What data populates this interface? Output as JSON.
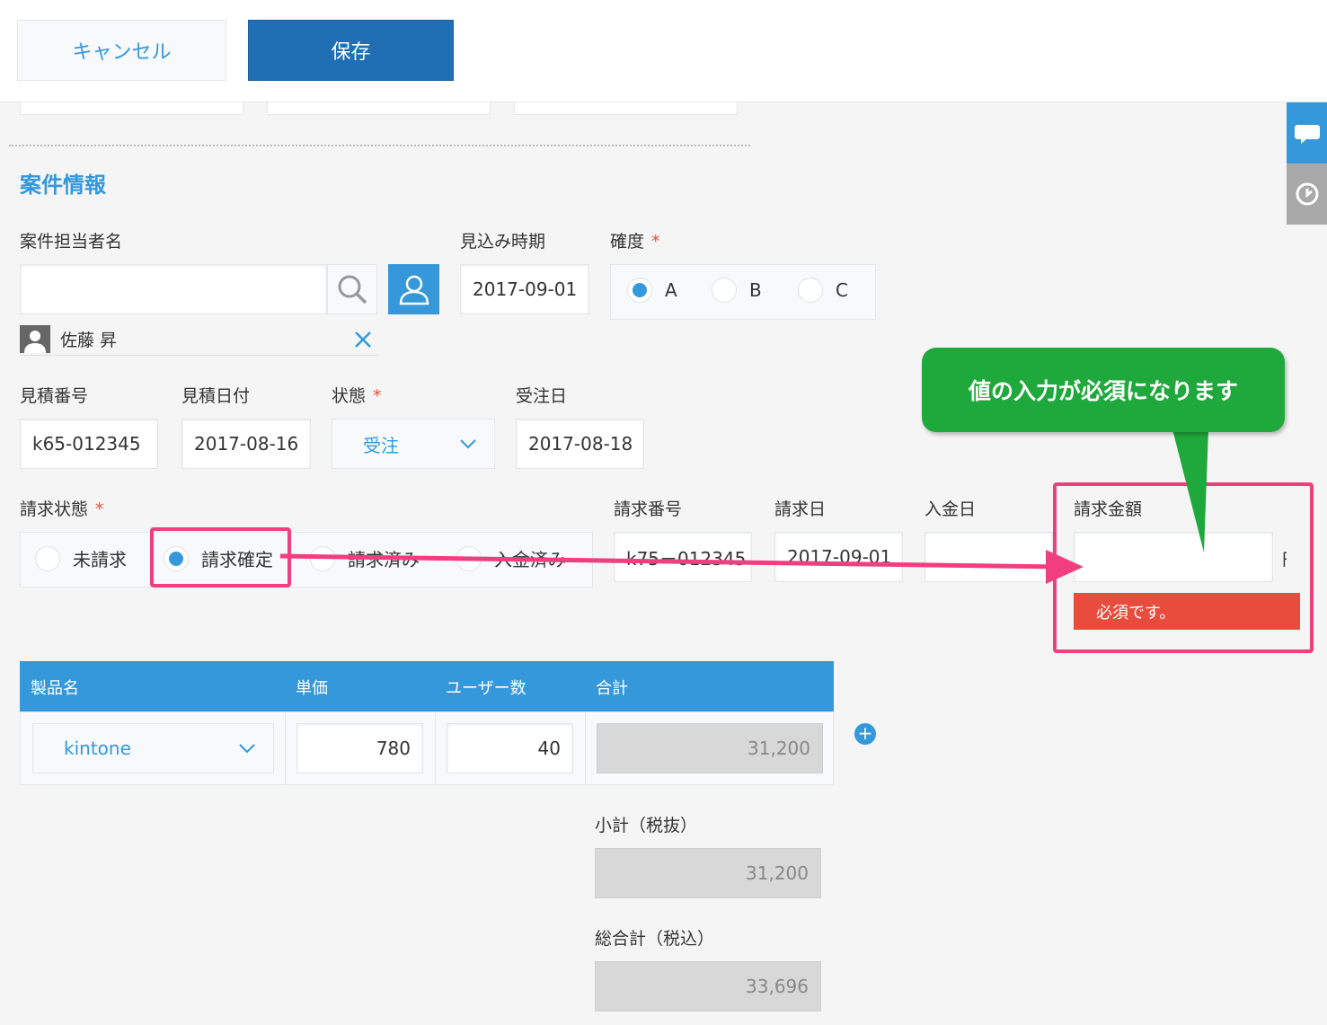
{
  "toolbar": {
    "cancel_label": "キャンセル",
    "save_label": "保存"
  },
  "section": {
    "title": "案件情報"
  },
  "fields": {
    "assignee": {
      "label": "案件担当者名",
      "value": "",
      "selected_user": "佐藤 昇"
    },
    "expected_date": {
      "label": "見込み時期",
      "value": "2017-09-01"
    },
    "certainty": {
      "label": "確度",
      "required_mark": "*",
      "options": [
        "A",
        "B",
        "C"
      ],
      "selected": "A"
    },
    "estimate_no": {
      "label": "見積番号",
      "value": "k65-012345"
    },
    "estimate_date": {
      "label": "見積日付",
      "value": "2017-08-16"
    },
    "status": {
      "label": "状態",
      "required_mark": "*",
      "value": "受注"
    },
    "order_date": {
      "label": "受注日",
      "value": "2017-08-18"
    },
    "billing_status": {
      "label": "請求状態",
      "required_mark": "*",
      "options": [
        "未請求",
        "請求確定",
        "請求済み",
        "入金済み"
      ],
      "selected": "請求確定"
    },
    "invoice_no": {
      "label": "請求番号",
      "value": "k75－012345"
    },
    "invoice_date": {
      "label": "請求日",
      "value": "2017-09-01"
    },
    "payment_date": {
      "label": "入金日",
      "value": ""
    },
    "invoice_amount": {
      "label": "請求金額",
      "value": "",
      "unit": "円",
      "error": "必須です。"
    }
  },
  "table": {
    "headers": [
      "製品名",
      "単価",
      "ユーザー数",
      "合計"
    ],
    "rows": [
      {
        "product": "kintone",
        "unit_price": "780",
        "users": "40",
        "total": "31,200"
      }
    ],
    "add_row": "+"
  },
  "totals": {
    "subtotal_label": "小計（税抜）",
    "subtotal": "31,200",
    "grand_total_label": "総合計（税込）",
    "grand_total": "33,696"
  },
  "annotation": {
    "callout": "値の入力が必須になります"
  },
  "colors": {
    "accent": "#3498db",
    "save": "#206eb3",
    "error": "#e74c3c",
    "callout": "#1fa83b",
    "highlight": "#f03e7f"
  }
}
